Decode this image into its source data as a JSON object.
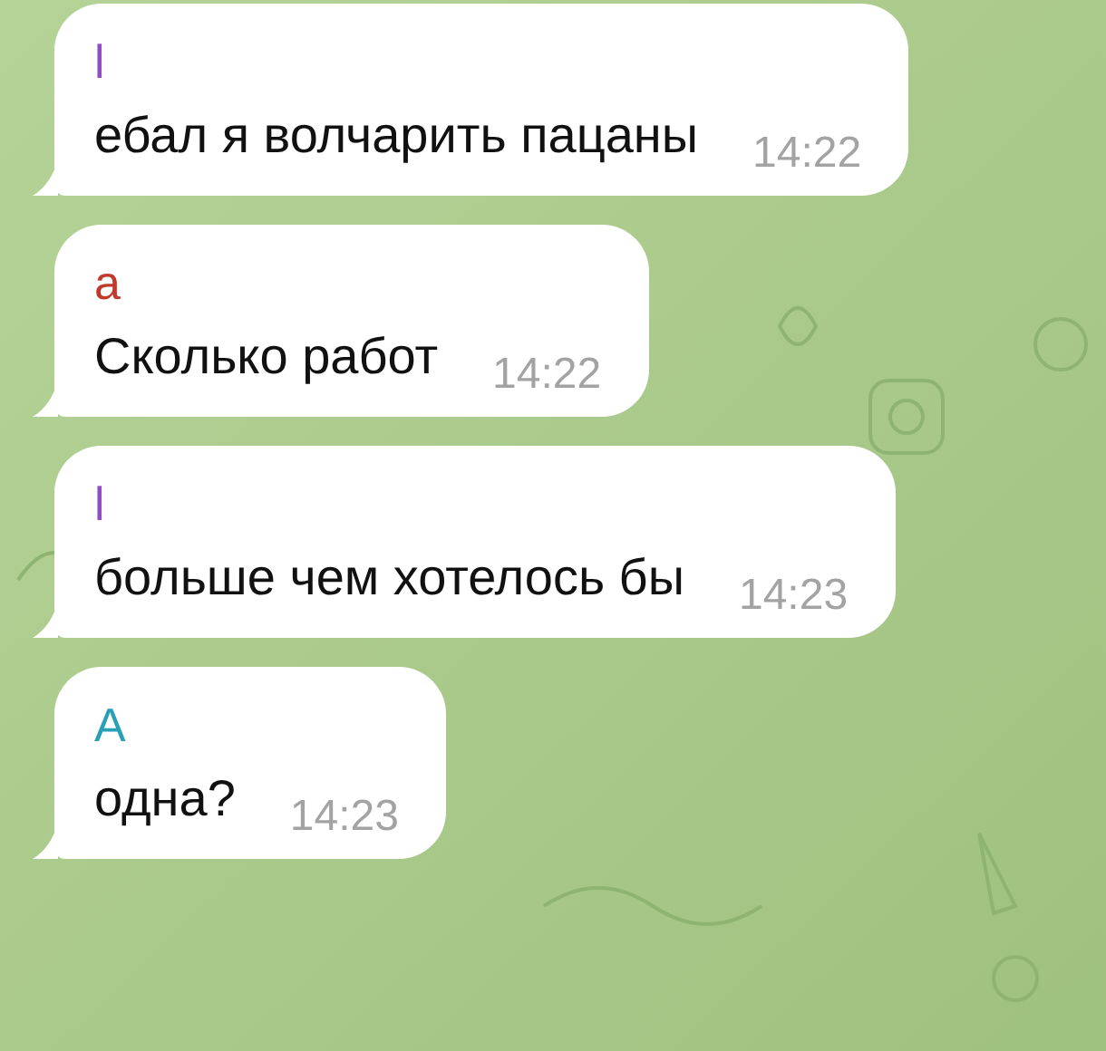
{
  "messages": [
    {
      "sender": "l",
      "color": "#8e4ec6",
      "text": "ебал я волчарить пацаны",
      "time": "14:22"
    },
    {
      "sender": "a",
      "color": "#c0392b",
      "text": "Сколько работ",
      "time": "14:22"
    },
    {
      "sender": "l",
      "color": "#8e4ec6",
      "text": "больше чем хотелось бы",
      "time": "14:23"
    },
    {
      "sender": "A",
      "color": "#2a9fb8",
      "text": "одна?",
      "time": "14:23"
    }
  ]
}
